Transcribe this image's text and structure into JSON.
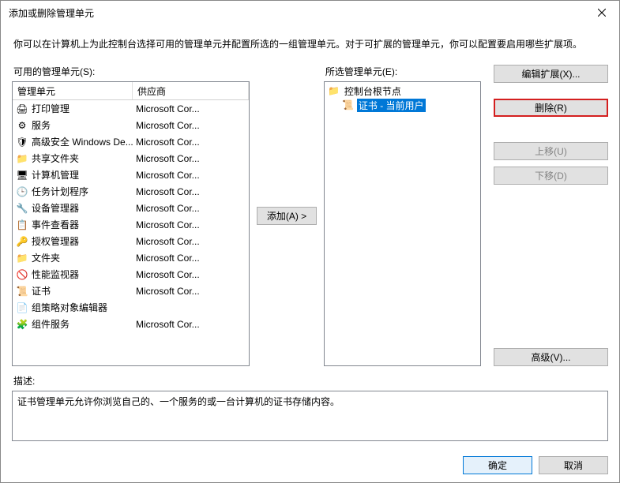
{
  "window": {
    "title": "添加或删除管理单元",
    "close_icon": "close-icon"
  },
  "instruction": "你可以在计算机上为此控制台选择可用的管理单元并配置所选的一组管理单元。对于可扩展的管理单元，你可以配置要启用哪些扩展项。",
  "available": {
    "label": "可用的管理单元(S):",
    "headers": {
      "snapin": "管理单元",
      "vendor": "供应商"
    },
    "rows": [
      {
        "icon": "printer-icon",
        "name": "打印管理",
        "vendor": "Microsoft Cor..."
      },
      {
        "icon": "gear-icon",
        "name": "服务",
        "vendor": "Microsoft Cor..."
      },
      {
        "icon": "shield-icon",
        "name": "高级安全 Windows De...",
        "vendor": "Microsoft Cor..."
      },
      {
        "icon": "folder-share-icon",
        "name": "共享文件夹",
        "vendor": "Microsoft Cor..."
      },
      {
        "icon": "computer-icon",
        "name": "计算机管理",
        "vendor": "Microsoft Cor..."
      },
      {
        "icon": "clock-icon",
        "name": "任务计划程序",
        "vendor": "Microsoft Cor..."
      },
      {
        "icon": "device-icon",
        "name": "设备管理器",
        "vendor": "Microsoft Cor..."
      },
      {
        "icon": "event-icon",
        "name": "事件查看器",
        "vendor": "Microsoft Cor..."
      },
      {
        "icon": "auth-icon",
        "name": "授权管理器",
        "vendor": "Microsoft Cor..."
      },
      {
        "icon": "folder-icon",
        "name": "文件夹",
        "vendor": "Microsoft Cor..."
      },
      {
        "icon": "perf-icon",
        "name": "性能监视器",
        "vendor": "Microsoft Cor..."
      },
      {
        "icon": "cert-icon",
        "name": "证书",
        "vendor": "Microsoft Cor..."
      },
      {
        "icon": "policy-icon",
        "name": "组策略对象编辑器",
        "vendor": ""
      },
      {
        "icon": "component-icon",
        "name": "组件服务",
        "vendor": "Microsoft Cor..."
      }
    ]
  },
  "add_button": "添加(A) >",
  "selected": {
    "label": "所选管理单元(E):",
    "root": {
      "icon": "folder-icon",
      "label": "控制台根节点"
    },
    "child": {
      "icon": "cert-icon",
      "label": "证书 - 当前用户"
    }
  },
  "side_buttons": {
    "edit_ext": "编辑扩展(X)...",
    "remove": "删除(R)",
    "move_up": "上移(U)",
    "move_down": "下移(D)",
    "advanced": "高级(V)..."
  },
  "description": {
    "label": "描述:",
    "text": "证书管理单元允许你浏览自己的、一个服务的或一台计算机的证书存储内容。"
  },
  "footer": {
    "ok": "确定",
    "cancel": "取消"
  },
  "icon_glyphs": {
    "printer-icon": "🖨",
    "gear-icon": "⚙",
    "shield-icon": "🛡",
    "folder-share-icon": "📁",
    "computer-icon": "🖥",
    "clock-icon": "🕒",
    "device-icon": "🔧",
    "event-icon": "📋",
    "auth-icon": "🔑",
    "folder-icon": "📁",
    "perf-icon": "🚫",
    "cert-icon": "📜",
    "policy-icon": "📄",
    "component-icon": "🧩",
    "close-icon": "✕"
  }
}
